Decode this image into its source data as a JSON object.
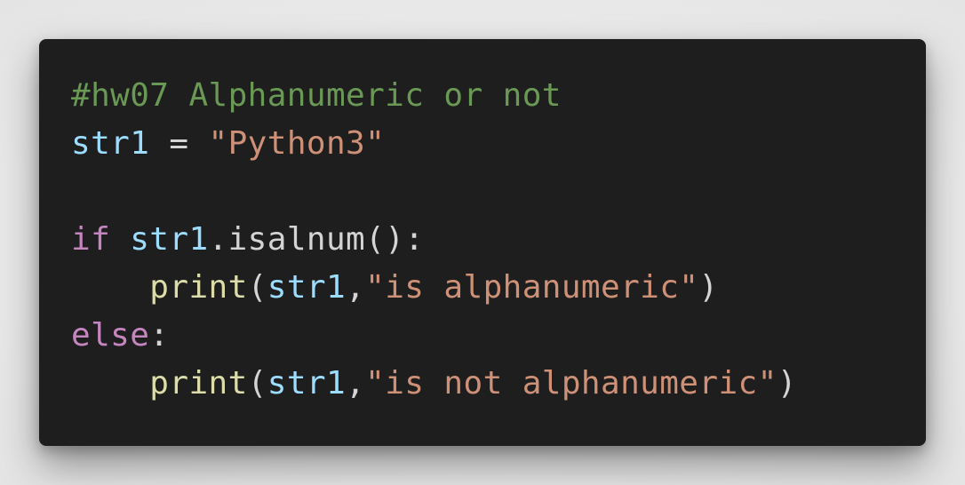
{
  "colors": {
    "page_background": "#e9e9e9",
    "editor_background": "#1e1e1e",
    "comment": "#6a9955",
    "variable": "#9cdcfe",
    "string": "#ce9178",
    "keyword": "#c586c0",
    "function": "#dcdcaa",
    "plain": "#d4d4d4"
  },
  "code": {
    "line1": {
      "comment": "#hw07 Alphanumeric or not"
    },
    "line2": {
      "var": "str1",
      "op": " = ",
      "string": "\"Python3\""
    },
    "line3": {
      "blank": ""
    },
    "line4": {
      "keyword": "if",
      "space": " ",
      "var": "str1",
      "method": ".isalnum():"
    },
    "line5": {
      "indent": "    ",
      "func": "print",
      "open": "(",
      "var": "str1",
      "comma": ",",
      "string": "\"is alphanumeric\"",
      "close": ")"
    },
    "line6": {
      "keyword": "else",
      "colon": ":"
    },
    "line7": {
      "indent": "    ",
      "func": "print",
      "open": "(",
      "var": "str1",
      "comma": ",",
      "string": "\"is not alphanumeric\"",
      "close": ")"
    }
  }
}
